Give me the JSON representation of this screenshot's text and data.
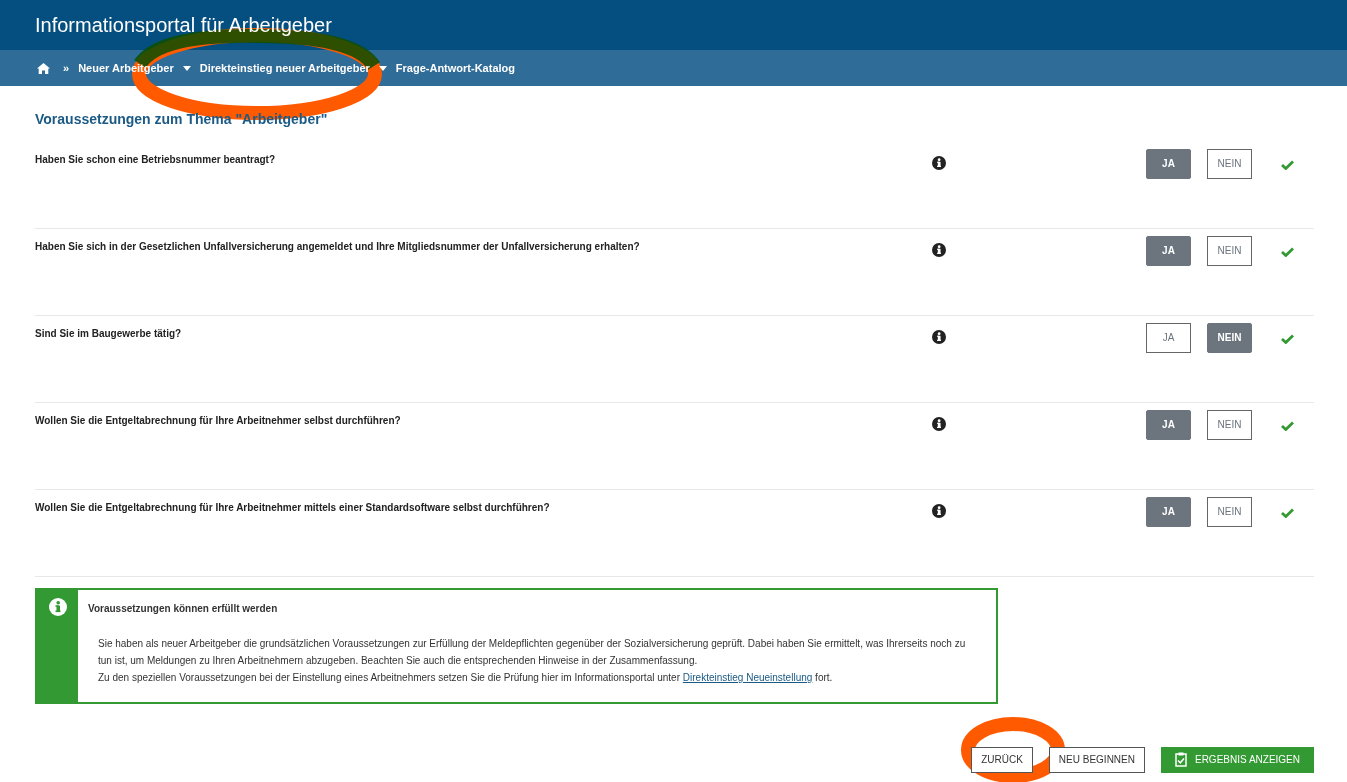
{
  "header": {
    "title": "Informationsportal für Arbeitgeber"
  },
  "breadcrumb": {
    "separator": "»",
    "items": [
      {
        "label": "Neuer Arbeitgeber",
        "dropdown": true
      },
      {
        "label": "Direkteinstieg neuer Arbeitgeber",
        "dropdown": true
      },
      {
        "label": "Frage-Antwort-Katalog",
        "dropdown": false
      }
    ]
  },
  "section_title": "Voraussetzungen zum Thema \"Arbeitgeber\"",
  "questions": [
    {
      "text": "Haben Sie schon eine Betriebsnummer beantragt?",
      "answered": true,
      "options": [
        {
          "label": "JA",
          "selected": true
        },
        {
          "label": "NEIN",
          "selected": false
        }
      ]
    },
    {
      "text": "Haben Sie sich in der Gesetzlichen Unfallversicherung angemeldet und Ihre Mitgliedsnummer der Unfallversicherung erhalten?",
      "answered": true,
      "options": [
        {
          "label": "JA",
          "selected": true
        },
        {
          "label": "NEIN",
          "selected": false
        }
      ]
    },
    {
      "text": "Sind Sie im Baugewerbe tätig?",
      "answered": true,
      "options": [
        {
          "label": "JA",
          "selected": false
        },
        {
          "label": "NEIN",
          "selected": true
        }
      ]
    },
    {
      "text": "Wollen Sie die Entgeltabrechnung für Ihre Arbeitnehmer selbst durchführen?",
      "answered": true,
      "options": [
        {
          "label": "JA",
          "selected": true
        },
        {
          "label": "NEIN",
          "selected": false
        }
      ]
    },
    {
      "text": "Wollen Sie die Entgeltabrechnung für Ihre Arbeitnehmer mittels einer Standardsoftware selbst durchführen?",
      "answered": true,
      "options": [
        {
          "label": "JA",
          "selected": true
        },
        {
          "label": "NEIN",
          "selected": false
        }
      ]
    }
  ],
  "result": {
    "title": "Voraussetzungen können erfüllt werden",
    "paragraph": "Sie haben als neuer Arbeitgeber die grundsätzlichen Voraussetzungen zur Erfüllung der Meldepflichten gegenüber der Sozialversicherung geprüft. Dabei haben Sie ermittelt, was Ihrerseits noch zu tun ist, um Meldungen zu Ihren Arbeitnehmern abzugeben. Beachten Sie auch die entsprechenden Hinweise in der Zusammenfassung.",
    "link_sentence": {
      "before": "Zu den speziellen Voraussetzungen bei der Einstellung eines Arbeitnehmers setzen Sie die Prüfung hier im Informationsportal unter ",
      "link": "Direkteinstieg Neueinstellung",
      "after": " fort."
    }
  },
  "actions": [
    {
      "label": "ZURÜCK",
      "kind": "outline"
    },
    {
      "label": "NEU BEGINNEN",
      "kind": "outline"
    },
    {
      "label": "ERGEBNIS ANZEIGEN",
      "kind": "primary"
    }
  ]
}
